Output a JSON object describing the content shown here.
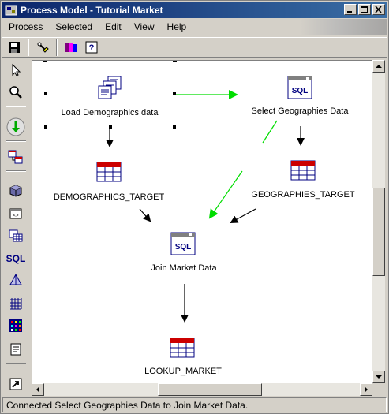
{
  "window": {
    "title": "Process Model - Tutorial Market"
  },
  "menu": {
    "items": [
      "Process",
      "Selected",
      "Edit",
      "View",
      "Help"
    ]
  },
  "toolbar": {
    "icons": [
      "save-icon",
      "highlight-icon",
      "warehouse-icon",
      "help-icon"
    ],
    "help_label": "?"
  },
  "palette": {
    "icons": [
      "pointer-icon",
      "zoom-icon",
      "task-flow-icon",
      "data-icon",
      "cube-icon",
      "program-icon",
      "tables-icon",
      "sql-icon",
      "transformer-icon",
      "grid-icon",
      "color-grid-icon",
      "note-icon",
      "shortcut-icon"
    ],
    "sql_label": "SQL"
  },
  "canvas": {
    "nodes": {
      "load_demographics": "Load Demographics data",
      "select_geographies": "Select Geographies Data",
      "demographics_target": "DEMOGRAPHICS_TARGET",
      "geographies_target": "GEOGRAPHIES_TARGET",
      "join_market": "Join Market Data",
      "lookup_market": "LOOKUP_MARKET"
    },
    "sql_icon_text": "SQL",
    "colors": {
      "data_link": "#000000",
      "task_flow_link": "#00cc00",
      "table_header": "#cc0000"
    }
  },
  "status": {
    "text": "Connected Select Geographies Data to Join Market Data."
  }
}
